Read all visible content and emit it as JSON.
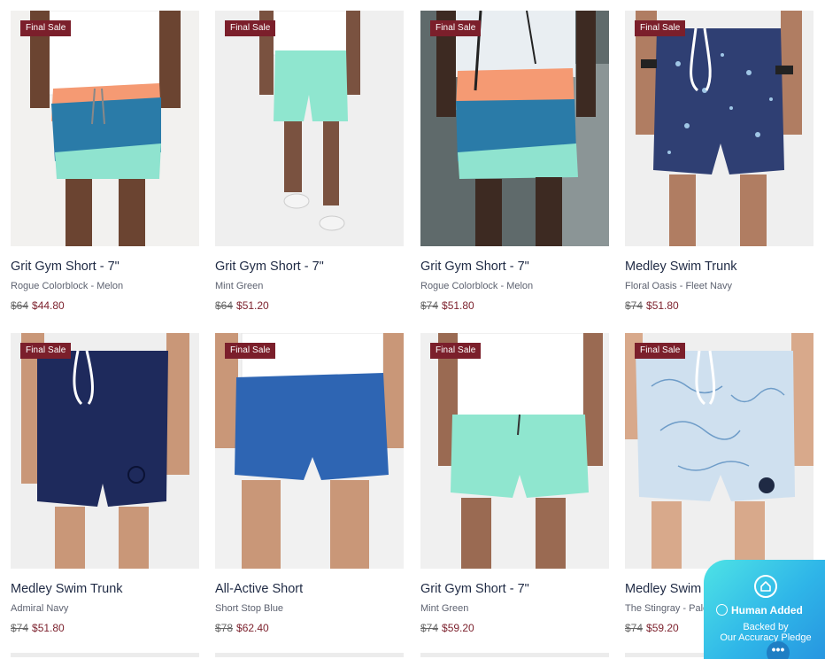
{
  "products": [
    {
      "badge": "Final Sale",
      "title": "Grit Gym Short - 7\"",
      "variant": "Rogue Colorblock - Melon",
      "price_original": "$64",
      "price_sale": "$44.80",
      "image": "rogue-colorblock-short-photo"
    },
    {
      "badge": "Final Sale",
      "title": "Grit Gym Short - 7\"",
      "variant": "Mint Green",
      "price_original": "$64",
      "price_sale": "$51.20",
      "image": "mint-green-short-photo"
    },
    {
      "badge": "Final Sale",
      "title": "Grit Gym Short - 7\"",
      "variant": "Rogue Colorblock - Melon",
      "price_original": "$74",
      "price_sale": "$51.80",
      "image": "rogue-colorblock-short-photo"
    },
    {
      "badge": "Final Sale",
      "title": "Medley Swim Trunk",
      "variant": "Floral Oasis - Fleet Navy",
      "price_original": "$74",
      "price_sale": "$51.80",
      "image": "floral-navy-trunk-photo"
    },
    {
      "badge": "Final Sale",
      "title": "Medley Swim Trunk",
      "variant": "Admiral Navy",
      "price_original": "$74",
      "price_sale": "$51.80",
      "image": "navy-trunk-photo"
    },
    {
      "badge": "Final Sale",
      "title": "All-Active Short",
      "variant": "Short Stop Blue",
      "price_original": "$78",
      "price_sale": "$62.40",
      "image": "blue-short-photo"
    },
    {
      "badge": "Final Sale",
      "title": "Grit Gym Short - 7\"",
      "variant": "Mint Green",
      "price_original": "$74",
      "price_sale": "$59.20",
      "image": "mint-green-short-photo"
    },
    {
      "badge": "Final Sale",
      "title": "Medley Swim Trunk",
      "variant": "The Stingray - Pale Bl",
      "price_original": "$74",
      "price_sale": "$59.20",
      "image": "stingray-trunk-photo"
    }
  ],
  "widget": {
    "icon": "house-icon",
    "title": "Human Added",
    "line1": "Backed by",
    "line2": "Our Accuracy Pledge",
    "menu": "•••"
  },
  "colors": {
    "badge": "#7b1f2b",
    "sale_price": "#7b1f2b",
    "title": "#1f2a44",
    "widget": "#2fb6e8"
  }
}
